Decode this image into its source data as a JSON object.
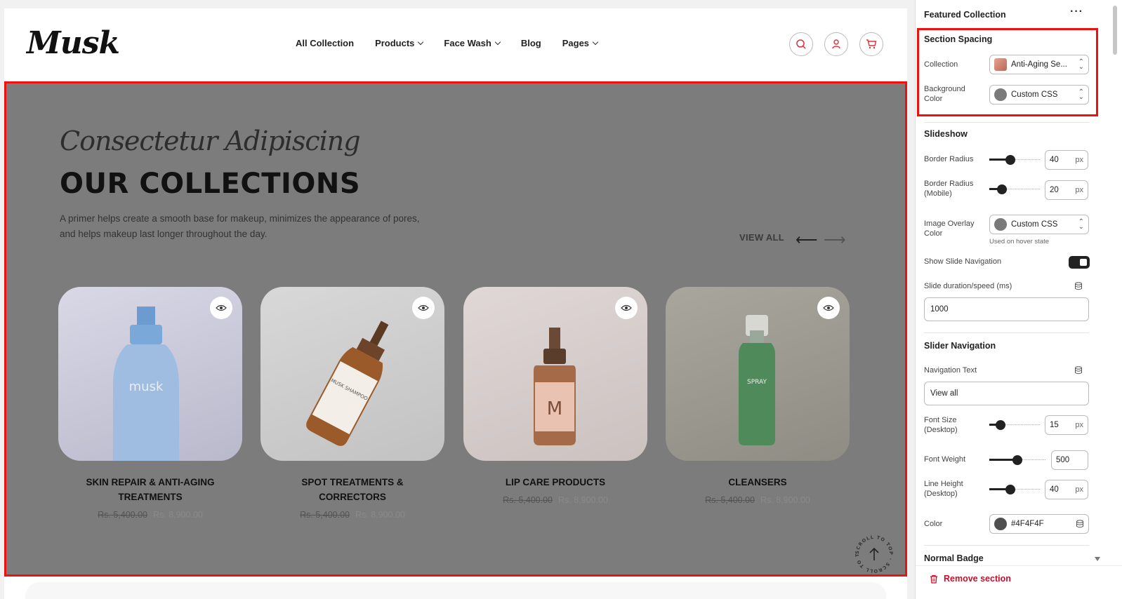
{
  "header": {
    "logo": "Musk",
    "nav": [
      {
        "label": "All Collection",
        "dropdown": false
      },
      {
        "label": "Products",
        "dropdown": true
      },
      {
        "label": "Face Wash",
        "dropdown": true
      },
      {
        "label": "Blog",
        "dropdown": false
      },
      {
        "label": "Pages",
        "dropdown": true
      }
    ],
    "icons": [
      "search-icon",
      "user-icon",
      "cart-icon"
    ]
  },
  "section": {
    "script_title": "Consectetur Adipiscing",
    "title": "OUR COLLECTIONS",
    "description": "A primer helps create a smooth base for makeup, minimizes the appearance of pores, and helps makeup last longer throughout the day.",
    "view_all": "VIEW ALL",
    "scroll_top_text": "SCROLL TO TOP · SCROLL TO TOP ·",
    "cards": [
      {
        "title": "SKIN REPAIR & ANTI-AGING TREATMENTS",
        "price_old": "Rs. 5,400.00",
        "price_new": "Rs. 8,900.00",
        "bg": "#c6c6d9",
        "bottle_text": "musk"
      },
      {
        "title": "SPOT TREATMENTS & CORRECTORS",
        "price_old": "Rs. 5,400.00",
        "price_new": "Rs. 8,900.00",
        "bg": "#cfcfcf",
        "bottle_text": "MUSK SHAMPOO"
      },
      {
        "title": "LIP CARE PRODUCTS",
        "price_old": "Rs. 5,400.00",
        "price_new": "Rs. 8,900.00",
        "bg": "#d4cccb",
        "bottle_text": "M"
      },
      {
        "title": "CLEANSERS",
        "price_old": "Rs. 5,400.00",
        "price_new": "Rs. 8,900.00",
        "bg": "#9d9a92",
        "bottle_text": "SPRAY"
      }
    ]
  },
  "panel": {
    "title": "Featured Collection",
    "menu": "···",
    "section_spacing": {
      "title": "Section Spacing",
      "collection_label": "Collection",
      "collection_value": "Anti-Aging Se...",
      "bg_label_1": "Background",
      "bg_label_2": "Color",
      "bg_value": "Custom CSS"
    },
    "slideshow": {
      "title": "Slideshow",
      "border_radius_label": "Border Radius",
      "border_radius_value": "40",
      "border_radius_mobile_label_1": "Border Radius",
      "border_radius_mobile_label_2": "(Mobile)",
      "border_radius_mobile_value": "20",
      "unit": "px",
      "overlay_label_1": "Image Overlay",
      "overlay_label_2": "Color",
      "overlay_value": "Custom CSS",
      "overlay_hint": "Used on hover state",
      "show_nav_label": "Show Slide Navigation",
      "show_nav_on": true,
      "duration_label": "Slide duration/speed (ms)",
      "duration_value": "1000"
    },
    "slider_navigation": {
      "title": "Slider Navigation",
      "nav_text_label": "Navigation Text",
      "nav_text_value": "View all",
      "font_size_label_1": "Font Size",
      "font_size_label_2": "(Desktop)",
      "font_size_value": "15",
      "font_weight_label": "Font Weight",
      "font_weight_value": "500",
      "line_height_label_1": "Line Height",
      "line_height_label_2": "(Desktop)",
      "line_height_value": "40",
      "color_label": "Color",
      "color_value": "#4F4F4F"
    },
    "normal_badge": "Normal Badge",
    "remove_section": "Remove section"
  },
  "colors": {
    "highlight": "#e11111",
    "section_bg": "#7c7c7c",
    "danger": "#c2102c",
    "swatch_gray": "#7a7a7a",
    "swatch_dark": "#4F4F4F"
  }
}
